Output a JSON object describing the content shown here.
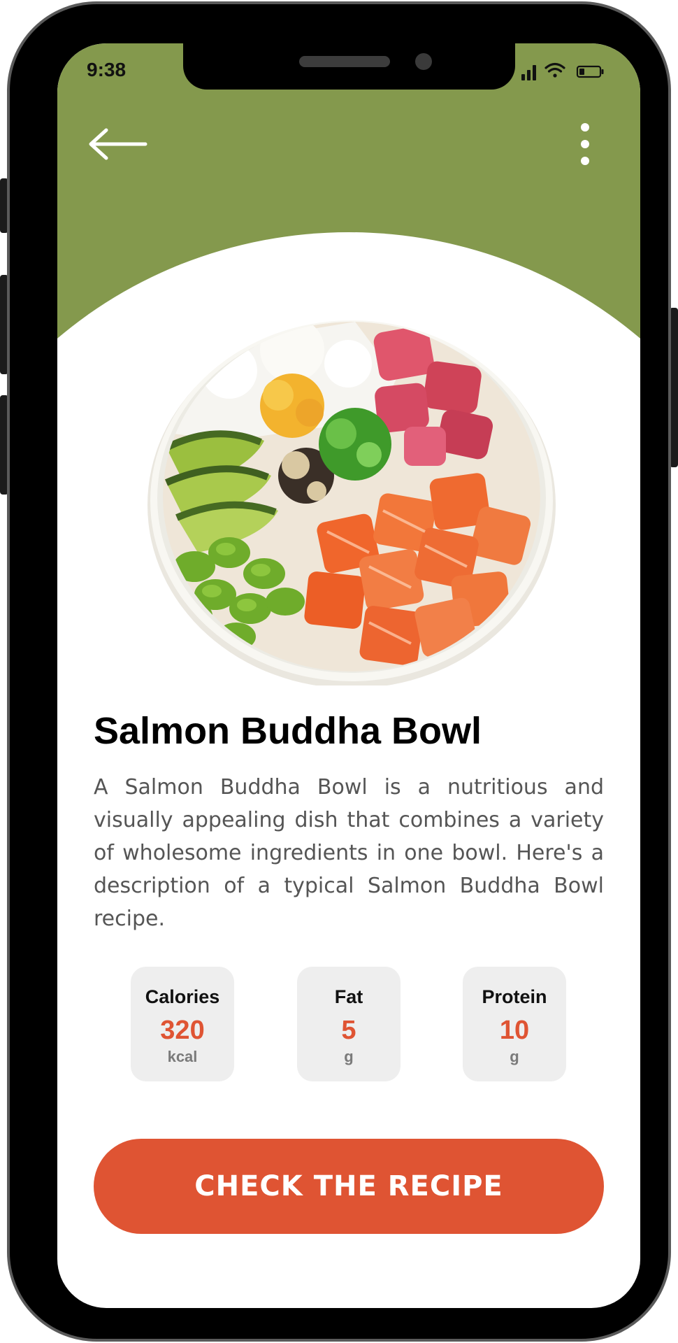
{
  "status_bar": {
    "time": "9:38"
  },
  "nav": {
    "back_icon": "back-arrow-icon",
    "menu_icon": "more-vertical-icon"
  },
  "recipe": {
    "title": "Salmon Buddha Bowl",
    "description": "A Salmon Buddha Bowl is a nutritious and visually appealing dish that combines a variety of wholesome ingredients in one bowl. Here's a description of a typical Salmon Buddha Bowl recipe."
  },
  "nutrition": [
    {
      "label": "Calories",
      "value": "320",
      "unit": "kcal"
    },
    {
      "label": "Fat",
      "value": "5",
      "unit": "g"
    },
    {
      "label": "Protein",
      "value": "10",
      "unit": "g"
    }
  ],
  "cta": {
    "label": "CHECK THE RECIPE"
  },
  "colors": {
    "header_green": "#84994d",
    "accent_orange": "#df5433",
    "card_gray": "#eeeeee",
    "text_gray": "#555555"
  }
}
